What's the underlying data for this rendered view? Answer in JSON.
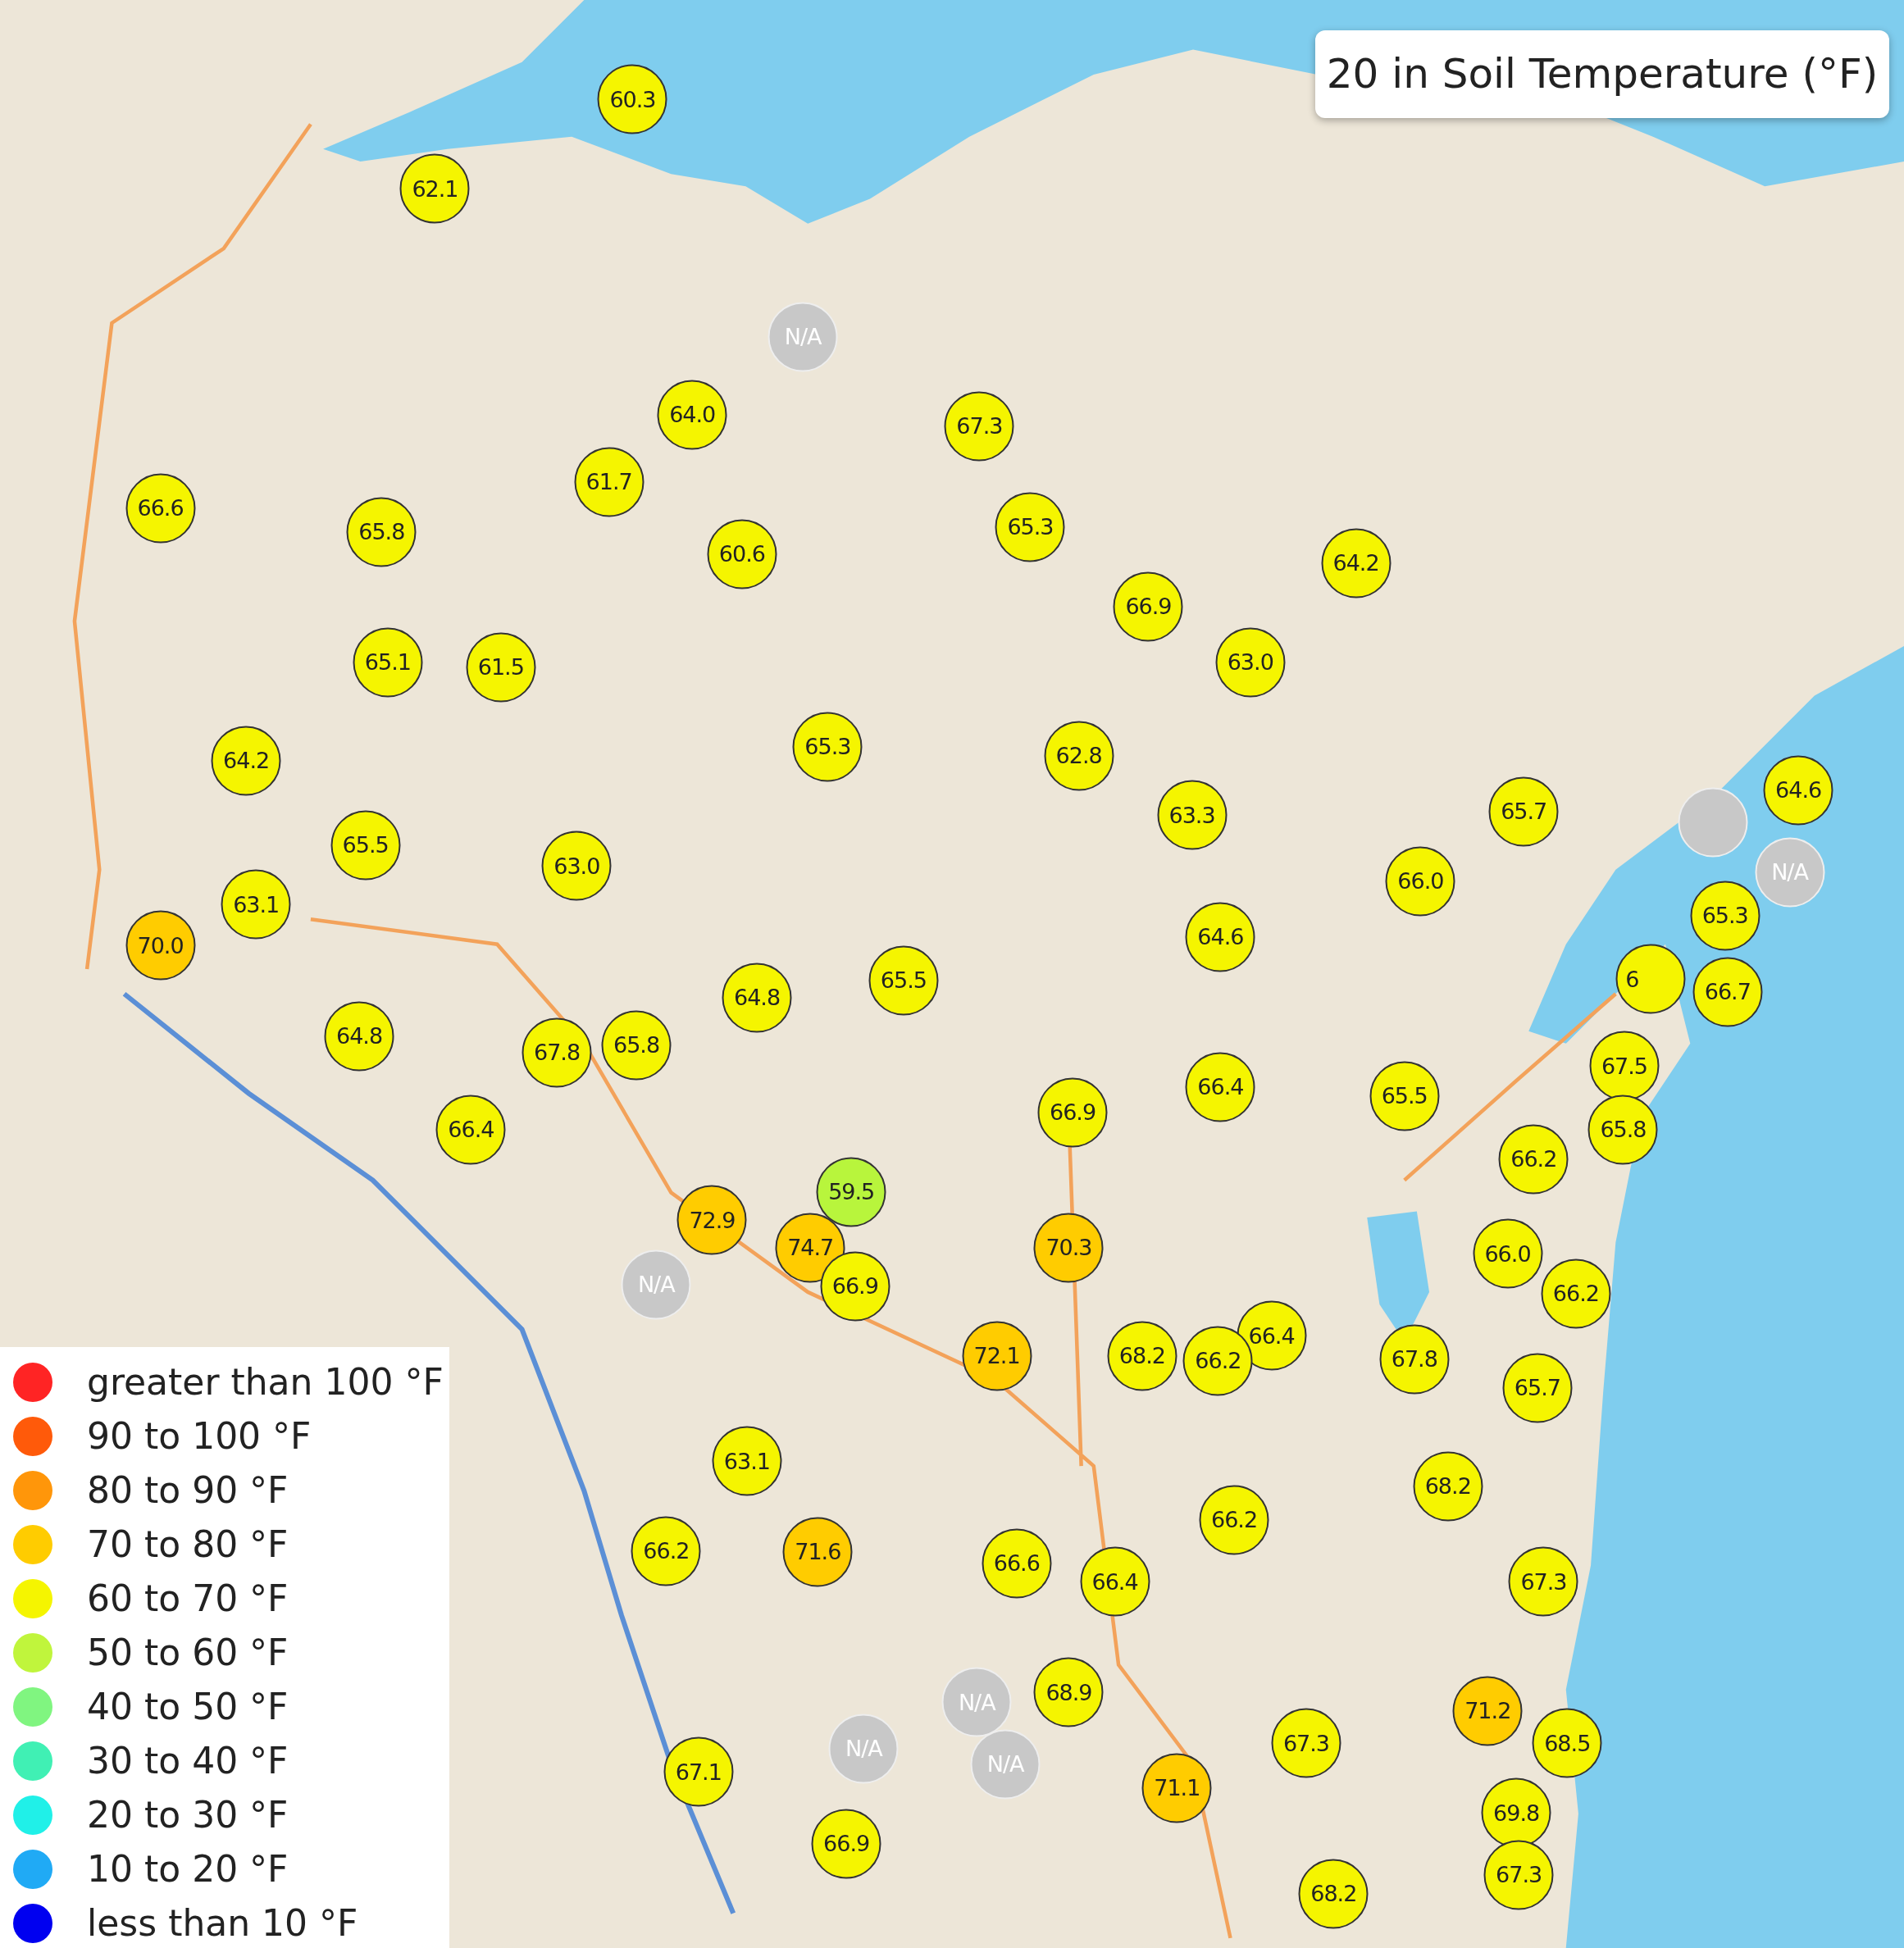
{
  "title": "20 in Soil Temperature (°F)",
  "legend": [
    {
      "label": "greater than 100 °F",
      "color": "#ff2424"
    },
    {
      "label": "90 to 100 °F",
      "color": "#ff5a0a"
    },
    {
      "label": "80 to 90 °F",
      "color": "#ff960a"
    },
    {
      "label": "70 to 80 °F",
      "color": "#ffcc00"
    },
    {
      "label": "60 to 70 °F",
      "color": "#f5f500"
    },
    {
      "label": "50 to 60 °F",
      "color": "#c0f53c"
    },
    {
      "label": "40 to 50 °F",
      "color": "#80f580"
    },
    {
      "label": "30 to 40 °F",
      "color": "#40f0b4"
    },
    {
      "label": "20 to 30 °F",
      "color": "#20f0e8"
    },
    {
      "label": "10 to 20 °F",
      "color": "#20aaf5"
    },
    {
      "label": "less than 10 °F",
      "color": "#0000f0"
    }
  ],
  "stations": [
    {
      "value": "60.3",
      "color": "#f5f500"
    },
    {
      "value": "62.1",
      "color": "#f5f500"
    },
    {
      "value": "N/A",
      "color": "#c8c8c8"
    },
    {
      "value": "64.0",
      "color": "#f5f500"
    },
    {
      "value": "67.3",
      "color": "#f5f500"
    },
    {
      "value": "61.7",
      "color": "#f5f500"
    },
    {
      "value": "66.6",
      "color": "#f5f500"
    },
    {
      "value": "65.8",
      "color": "#f5f500"
    },
    {
      "value": "60.6",
      "color": "#f5f500"
    },
    {
      "value": "65.3",
      "color": "#f5f500"
    },
    {
      "value": "64.2",
      "color": "#f5f500"
    },
    {
      "value": "66.9",
      "color": "#f5f500"
    },
    {
      "value": "65.1",
      "color": "#f5f500"
    },
    {
      "value": "61.5",
      "color": "#f5f500"
    },
    {
      "value": "63.0",
      "color": "#f5f500"
    },
    {
      "value": "64.2",
      "color": "#f5f500"
    },
    {
      "value": "65.3",
      "color": "#f5f500"
    },
    {
      "value": "62.8",
      "color": "#f5f500"
    },
    {
      "value": "63.3",
      "color": "#f5f500"
    },
    {
      "value": "65.7",
      "color": "#f5f500"
    },
    {
      "value": "64.6",
      "color": "#f5f500"
    },
    {
      "color": "#c8c8c8"
    },
    {
      "value": "N/A",
      "color": "#c8c8c8"
    },
    {
      "value": "65.5",
      "color": "#f5f500"
    },
    {
      "value": "63.0",
      "color": "#f5f500"
    },
    {
      "value": "66.0",
      "color": "#f5f500"
    },
    {
      "value": "63.1",
      "color": "#f5f500"
    },
    {
      "value": "70.0",
      "color": "#ffcc00"
    },
    {
      "value": "64.6",
      "color": "#f5f500"
    },
    {
      "value": "65.3",
      "color": "#f5f500"
    },
    {
      "value": "6",
      "color": "#f5f500"
    },
    {
      "value": "66.7",
      "color": "#f5f500"
    },
    {
      "value": "65.5",
      "color": "#f5f500"
    },
    {
      "value": "64.8",
      "color": "#f5f500"
    },
    {
      "value": "64.8",
      "color": "#f5f500"
    },
    {
      "value": "67.8",
      "color": "#f5f500"
    },
    {
      "value": "65.8",
      "color": "#f5f500"
    },
    {
      "value": "66.4",
      "color": "#f5f500"
    },
    {
      "value": "66.9",
      "color": "#f5f500"
    },
    {
      "value": "65.5",
      "color": "#f5f500"
    },
    {
      "value": "67.5",
      "color": "#f5f500"
    },
    {
      "value": "65.8",
      "color": "#f5f500"
    },
    {
      "value": "66.4",
      "color": "#f5f500"
    },
    {
      "value": "66.2",
      "color": "#f5f500"
    },
    {
      "value": "59.5",
      "color": "#b8f53c"
    },
    {
      "value": "72.9",
      "color": "#ffcc00"
    },
    {
      "value": "74.7",
      "color": "#ffcc00"
    },
    {
      "value": "70.3",
      "color": "#ffcc00"
    },
    {
      "value": "66.0",
      "color": "#f5f500"
    },
    {
      "value": "66.2",
      "color": "#f5f500"
    },
    {
      "value": "N/A",
      "color": "#c8c8c8"
    },
    {
      "value": "66.9",
      "color": "#f5f500"
    },
    {
      "value": "72.1",
      "color": "#ffcc00"
    },
    {
      "value": "68.2",
      "color": "#f5f500"
    },
    {
      "value": "66.4",
      "color": "#f5f500"
    },
    {
      "value": "66.2",
      "color": "#f5f500"
    },
    {
      "value": "67.8",
      "color": "#f5f500"
    },
    {
      "value": "65.7",
      "color": "#f5f500"
    },
    {
      "value": "63.1",
      "color": "#f5f500"
    },
    {
      "value": "68.2",
      "color": "#f5f500"
    },
    {
      "value": "66.2",
      "color": "#f5f500"
    },
    {
      "value": "71.6",
      "color": "#ffcc00"
    },
    {
      "value": "66.6",
      "color": "#f5f500"
    },
    {
      "value": "66.4",
      "color": "#f5f500"
    },
    {
      "value": "66.2",
      "color": "#f5f500"
    },
    {
      "value": "67.3",
      "color": "#f5f500"
    },
    {
      "value": "67.1",
      "color": "#f5f500"
    },
    {
      "value": "N/A",
      "color": "#c8c8c8"
    },
    {
      "value": "N/A",
      "color": "#c8c8c8"
    },
    {
      "value": "N/A",
      "color": "#c8c8c8"
    },
    {
      "value": "68.9",
      "color": "#f5f500"
    },
    {
      "value": "71.1",
      "color": "#ffcc00"
    },
    {
      "value": "67.3",
      "color": "#f5f500"
    },
    {
      "value": "71.2",
      "color": "#ffcc00"
    },
    {
      "value": "68.5",
      "color": "#f5f500"
    },
    {
      "value": "66.9",
      "color": "#f5f500"
    },
    {
      "value": "69.8",
      "color": "#f5f500"
    },
    {
      "value": "68.2",
      "color": "#f5f500"
    },
    {
      "value": "67.3",
      "color": "#f5f500"
    }
  ]
}
